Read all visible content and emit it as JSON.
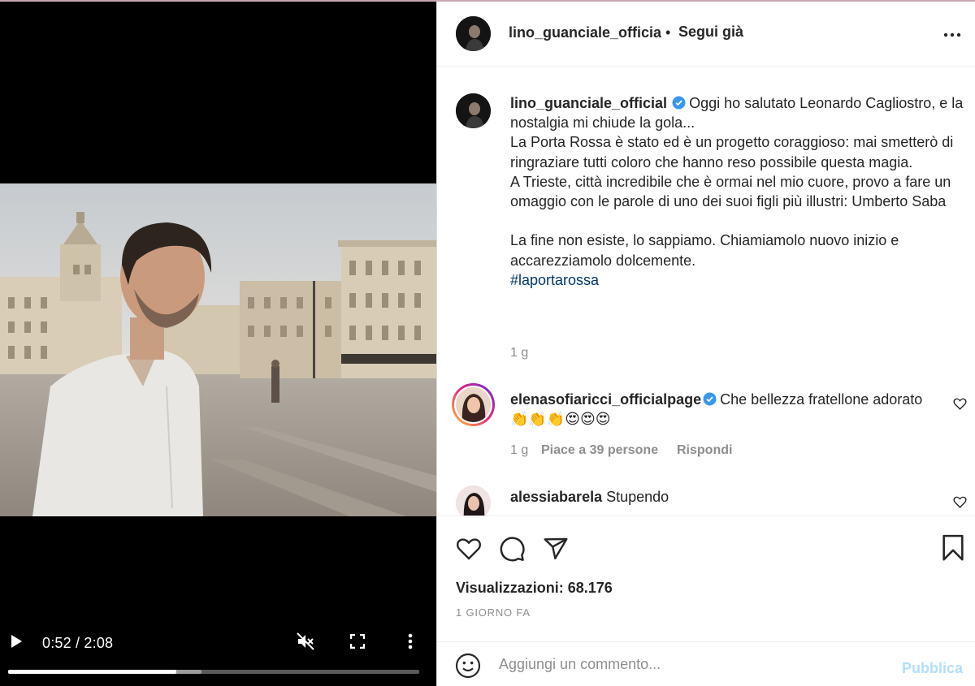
{
  "video": {
    "current_time": "0:52",
    "duration": "2:08",
    "time_display": "0:52 / 2:08",
    "progress_fraction": 0.41,
    "buffered_fraction": 0.47,
    "muted": true
  },
  "post": {
    "author": "lino_guanciale_officia",
    "author_separator": "•",
    "follow_status": "Segui già",
    "caption_author": "lino_guanciale_official",
    "caption_text": "Oggi ho salutato Leonardo Cagliostro, e la nostalgia mi chiude la gola...\nLa Porta Rossa è stato ed è un progetto coraggioso: mai smetterò di ringraziare tutti coloro che hanno reso possibile questa magia.\nA Trieste, città incredibile che è ormai nel mio cuore, provo a fare un omaggio con le parole di uno dei suoi figli più illustri: Umberto Saba\n\nLa fine non esiste, lo sappiamo. Chiamiamolo nuovo inizio e accarezziamolo dolcemente.",
    "hashtag": "#laportarossa",
    "caption_age": "1 g",
    "views_label": "Visualizzazioni: 68.176",
    "date_label": "1 GIORNO FA"
  },
  "comments": [
    {
      "author": "elenasofiaricci_officialpage",
      "text": "Che bellezza fratellone adorato 👏👏👏😍😍😍",
      "age": "1 g",
      "likes": "Piace a 39 persone",
      "reply": "Rispondi"
    },
    {
      "author": "alessiabarela",
      "text": "Stupendo"
    }
  ],
  "add_comment": {
    "placeholder": "Aggiungi un commento...",
    "publish_label": "Pubblica"
  },
  "colors": {
    "hashtag": "#00376b",
    "verified": "#3897f0",
    "publish_disabled": "#b2dffc",
    "muted_text": "#8e8e8e"
  },
  "icons": [
    "play-icon",
    "mute-icon",
    "fullscreen-icon",
    "more-vertical-icon",
    "more-horizontal-icon",
    "verified-icon",
    "heart-icon",
    "comment-icon",
    "share-icon",
    "bookmark-icon",
    "emoji-icon"
  ]
}
